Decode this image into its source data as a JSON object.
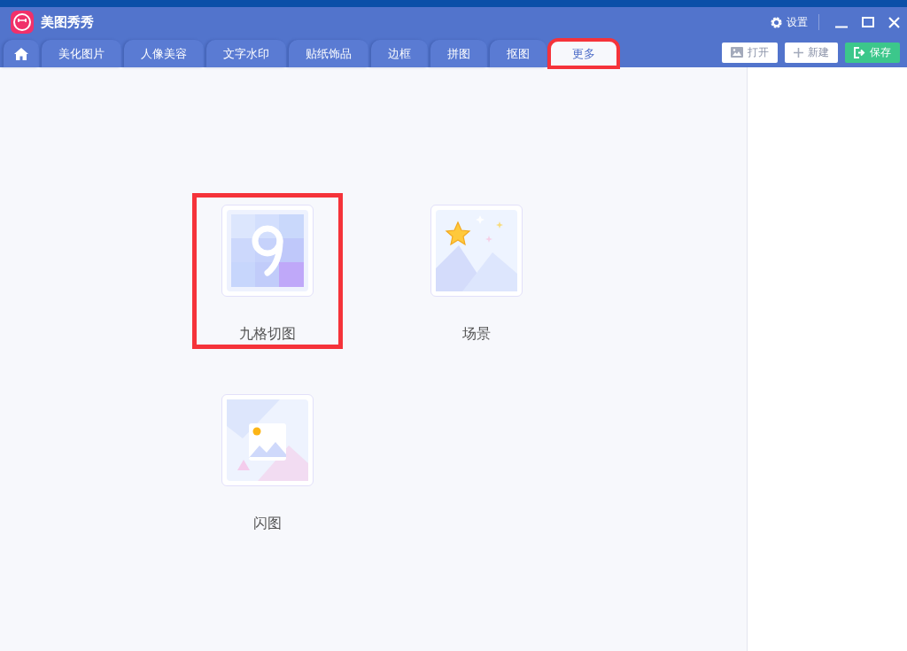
{
  "window": {
    "title": "美图秀秀",
    "settings_label": "设置"
  },
  "tabs": [
    {
      "kind": "home",
      "selected": false,
      "highlighted": false
    },
    {
      "kind": "text",
      "label": "美化图片",
      "selected": false,
      "highlighted": false
    },
    {
      "kind": "text",
      "label": "人像美容",
      "selected": false,
      "highlighted": false
    },
    {
      "kind": "text",
      "label": "文字水印",
      "selected": false,
      "highlighted": false
    },
    {
      "kind": "text",
      "label": "贴纸饰品",
      "selected": false,
      "highlighted": false
    },
    {
      "kind": "text",
      "label": "边框",
      "selected": false,
      "highlighted": false
    },
    {
      "kind": "text",
      "label": "拼图",
      "selected": false,
      "highlighted": false
    },
    {
      "kind": "text",
      "label": "抠图",
      "selected": false,
      "highlighted": false
    },
    {
      "kind": "text",
      "label": "更多",
      "selected": true,
      "highlighted": true
    }
  ],
  "actions": [
    {
      "kind": "open",
      "label": "打开"
    },
    {
      "kind": "new",
      "label": "新建"
    },
    {
      "kind": "save",
      "label": "保存"
    }
  ],
  "tools": [
    {
      "kind": "grid",
      "label": "九格切图",
      "highlighted": true
    },
    {
      "kind": "scene",
      "label": "场景",
      "highlighted": false
    },
    {
      "kind": "flash",
      "label": "闪图",
      "highlighted": false
    }
  ]
}
